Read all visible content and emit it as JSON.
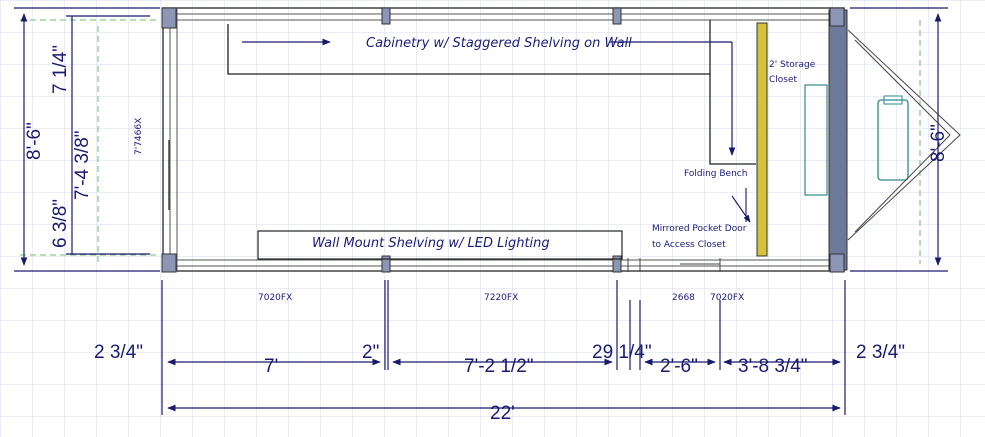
{
  "annotations": {
    "cabinetry": "Cabinetry w/ Staggered Shelving on Wall",
    "wall_shelving": "Wall Mount Shelving w/ LED Lighting",
    "storage_closet_line1": "2' Storage",
    "storage_closet_line2": "Closet",
    "folding_bench": "Folding Bench",
    "pocket_door_line1": "Mirrored Pocket Door",
    "pocket_door_line2": "to Access Closet"
  },
  "window_labels": {
    "left_wall": "7'7466X",
    "w1": "7020FX",
    "w2": "7220FX",
    "door": "2668",
    "w3": "7020FX"
  },
  "dimensions": {
    "left_total": "8'-6\"",
    "left_top": "7 1/4\"",
    "left_mid": "7'-4 3/8\"",
    "left_bottom": "6 3/8\"",
    "right_total": "8'-6\"",
    "bottom_left_offset": "2 3/4\"",
    "seg1": "7'",
    "seg2": "2\"",
    "seg3": "7'-2 1/2\"",
    "seg4": "29 1/4\"",
    "seg5": "2'-6\"",
    "seg6": "3'-8 3/4\"",
    "bottom_right_offset": "2 3/4\"",
    "overall": "22'"
  },
  "colors": {
    "grid": "#d7dbe8",
    "ink": "#1a1a6e",
    "wall_post": "#6b7a99",
    "bench": "#d6c23a",
    "fixture": "#2e8a8a",
    "guide": "#6fbf6f"
  }
}
